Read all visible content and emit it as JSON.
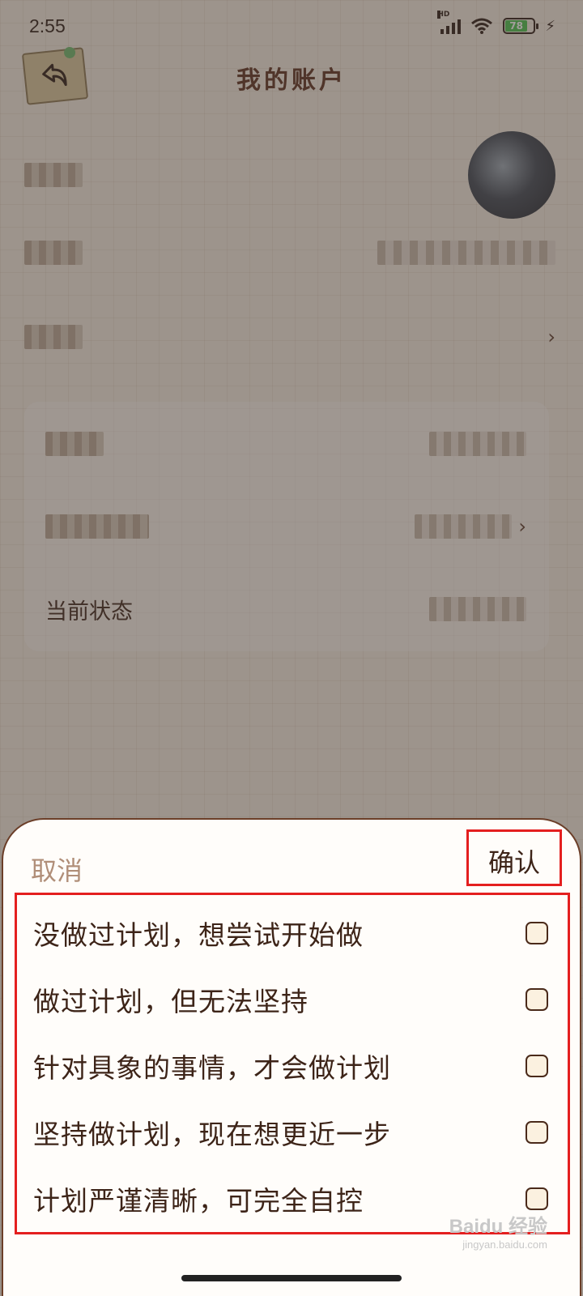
{
  "status_bar": {
    "time": "2:55",
    "network": "HD",
    "battery_level": "78",
    "battery_color": "#46c04a"
  },
  "nav": {
    "title": "我的账户",
    "back_icon": "back-arrow-icon"
  },
  "background": {
    "current_status_label": "当前状态"
  },
  "sheet": {
    "cancel_label": "取消",
    "confirm_label": "确认",
    "options": [
      "没做过计划，想尝试开始做",
      "做过计划，但无法坚持",
      "针对具象的事情，才会做计划",
      "坚持做计划，现在想更近一步",
      "计划严谨清晰，可完全自控"
    ],
    "highlight_color": "#e41f1f"
  },
  "watermark": {
    "brand": "Baidu 经验",
    "url": "jingyan.baidu.com"
  }
}
